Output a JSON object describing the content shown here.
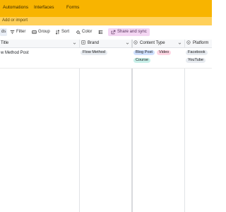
{
  "top_nav": {
    "items": [
      "Automations",
      "Interfaces",
      "Forms"
    ]
  },
  "add_bar": {
    "label": "Add or import"
  },
  "toolbar": {
    "fields_partial": "ds",
    "filter": "Filter",
    "group": "Group",
    "sort": "Sort",
    "color": "Color",
    "share": "Share and sync"
  },
  "columns": [
    {
      "label": "Title"
    },
    {
      "label": "Brand"
    },
    {
      "label": "Content Type"
    },
    {
      "label": "Platform"
    }
  ],
  "rows": [
    {
      "title": "w Method Post",
      "brand": "Flow Method",
      "content_types": [
        {
          "label": "Blog Post",
          "color": "#cfe0ff"
        },
        {
          "label": "Video",
          "color": "#ffd6e4"
        },
        {
          "label": "Course",
          "color": "#c9f0ea"
        }
      ],
      "platforms": [
        {
          "label": "Facebook",
          "color": "#e7ebf0"
        },
        {
          "label": "YouTube",
          "color": "#e7ebf0"
        }
      ]
    }
  ],
  "colors": {
    "topnav_bg": "#f8b400",
    "addbar_bg": "#ffd05a",
    "share_bg": "#f4d6f3"
  }
}
